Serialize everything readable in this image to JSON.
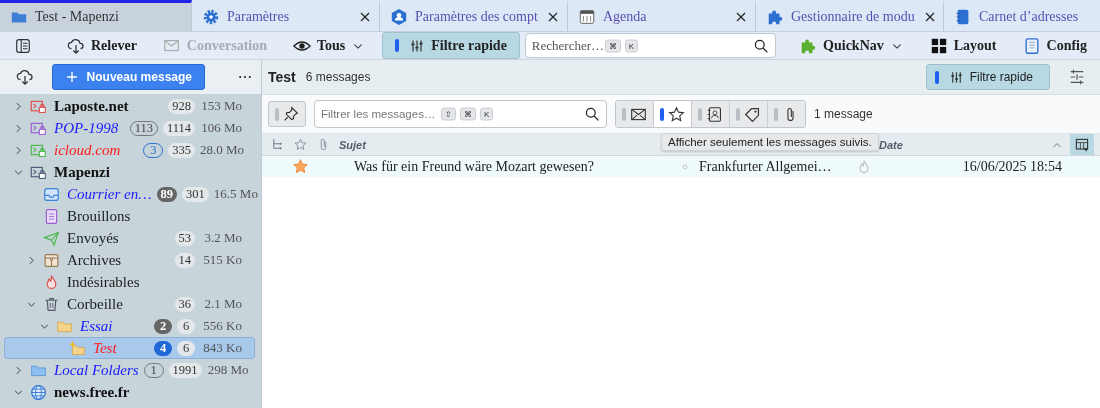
{
  "tabs": [
    {
      "label": "Test - Mapenzi",
      "selected": true,
      "closable": false
    },
    {
      "label": "Paramètres",
      "selected": false,
      "closable": true
    },
    {
      "label": "Paramètres des compt",
      "selected": false,
      "closable": true
    },
    {
      "label": "Agenda",
      "selected": false,
      "closable": true
    },
    {
      "label": "Gestionnaire de modu",
      "selected": false,
      "closable": true
    },
    {
      "label": "Carnet d’adresses",
      "selected": false,
      "closable": false
    }
  ],
  "toolbar": {
    "items": [
      {
        "kind": "icon-button"
      },
      {
        "kind": "button",
        "label": "Relever",
        "disabled": false
      },
      {
        "kind": "button",
        "label": "Conversation",
        "disabled": true
      },
      {
        "kind": "menu",
        "label": "Tous"
      },
      {
        "kind": "toggle",
        "label": "Filtre rapide",
        "selected": true
      },
      {
        "kind": "search",
        "placeholder": "Rechercher…",
        "keys": [
          "⌘",
          "K"
        ]
      },
      {
        "kind": "menu",
        "label": "QuickNav"
      },
      {
        "kind": "button",
        "label": "Layout",
        "disabled": false
      },
      {
        "kind": "button",
        "label": "Config",
        "disabled": false
      }
    ]
  },
  "sidebar": {
    "new_message_button": "Nouveau message",
    "folders": [
      {
        "name": "Laposte.net",
        "kind": "account",
        "color": "#111111",
        "italic": false,
        "bold": true,
        "total": "928",
        "size": "153 Mo",
        "expanded": false,
        "selected": false
      },
      {
        "name": "POP-1998",
        "kind": "account",
        "color": "#1a1aff",
        "italic": true,
        "bold": false,
        "unread": {
          "text": "113",
          "kind": "outline"
        },
        "total": "1114",
        "size": "106 Mo",
        "expanded": false,
        "selected": false
      },
      {
        "name": "icloud.com",
        "kind": "account",
        "color": "#ff1a1a",
        "italic": true,
        "bold": false,
        "unread": {
          "text": "3",
          "kind": "accent"
        },
        "total": "335",
        "size": "28.0 Mo",
        "expanded": false,
        "selected": false
      },
      {
        "name": "Mapenzi",
        "kind": "account",
        "color": "#111111",
        "italic": false,
        "bold": true,
        "expanded": true,
        "selected": false,
        "children": [
          {
            "name": "Courrier en…",
            "kind": "inbox",
            "color": "#1a1aff",
            "italic": true,
            "bold": false,
            "unread": {
              "text": "89",
              "kind": "dark"
            },
            "total": "301",
            "size": "16.5 Mo",
            "selected": false
          },
          {
            "name": "Brouillons",
            "kind": "drafts",
            "color": "#222222",
            "italic": false,
            "bold": false,
            "selected": false
          },
          {
            "name": "Envoyés",
            "kind": "sent",
            "color": "#222222",
            "italic": false,
            "bold": false,
            "total": "53",
            "size": "3.2 Mo",
            "selected": false
          },
          {
            "name": "Archives",
            "kind": "archive",
            "color": "#222222",
            "italic": false,
            "bold": false,
            "total": "14",
            "size": "515 Ko",
            "expanded": false,
            "selected": false
          },
          {
            "name": "Indésirables",
            "kind": "junk",
            "color": "#222222",
            "italic": false,
            "bold": false,
            "selected": false
          },
          {
            "name": "Corbeille",
            "kind": "trash",
            "color": "#222222",
            "italic": false,
            "bold": false,
            "total": "36",
            "size": "2.1 Mo",
            "expanded": true,
            "selected": false,
            "children": [
              {
                "name": "Essai",
                "kind": "folder",
                "color": "#1a1aff",
                "italic": true,
                "bold": false,
                "unread": {
                  "text": "2",
                  "kind": "dark"
                },
                "total": "6",
                "size": "556 Ko",
                "expanded": true,
                "selected": false,
                "children": [
                  {
                    "name": "Test",
                    "kind": "newfolder",
                    "color": "#ff1a1a",
                    "italic": true,
                    "bold": false,
                    "unread": {
                      "text": "4",
                      "kind": "blue"
                    },
                    "total": "6",
                    "size": "843 Ko",
                    "selected": true
                  }
                ]
              }
            ]
          }
        ]
      },
      {
        "name": "Local Folders",
        "kind": "local",
        "color": "#1a1aff",
        "italic": true,
        "bold": false,
        "unread": {
          "text": "1",
          "kind": "outline"
        },
        "total": "1991",
        "size": "298 Mo",
        "expanded": false,
        "selected": false
      },
      {
        "name": "news.free.fr",
        "kind": "news",
        "color": "#111111",
        "italic": false,
        "bold": true,
        "expanded": true,
        "selected": false
      }
    ]
  },
  "main": {
    "folder_title": "Test",
    "message_count": "6 messages",
    "quick_filter_button": {
      "label": "Filtre rapide",
      "selected": true
    },
    "filter_bar": {
      "pinned": false,
      "placeholder": "Filtrer les messages…",
      "keys": [
        "⇧",
        "⌘",
        "K"
      ],
      "toggles": [
        {
          "selected": false
        },
        {
          "selected": true
        },
        {
          "selected": false
        },
        {
          "selected": false
        },
        {
          "selected": false
        }
      ],
      "result": "1 message"
    },
    "columns": [
      {
        "label": "Sujet"
      },
      {
        "label": "Date"
      }
    ],
    "messages": [
      {
        "starred": true,
        "subject": "Was für ein Freund wäre Mozart gewesen?",
        "correspondent": "Frankfurter Allgemei…",
        "date": "16/06/2025 18:54",
        "selected": true
      }
    ],
    "tooltip": "Afficher seulement les messages suivis."
  }
}
